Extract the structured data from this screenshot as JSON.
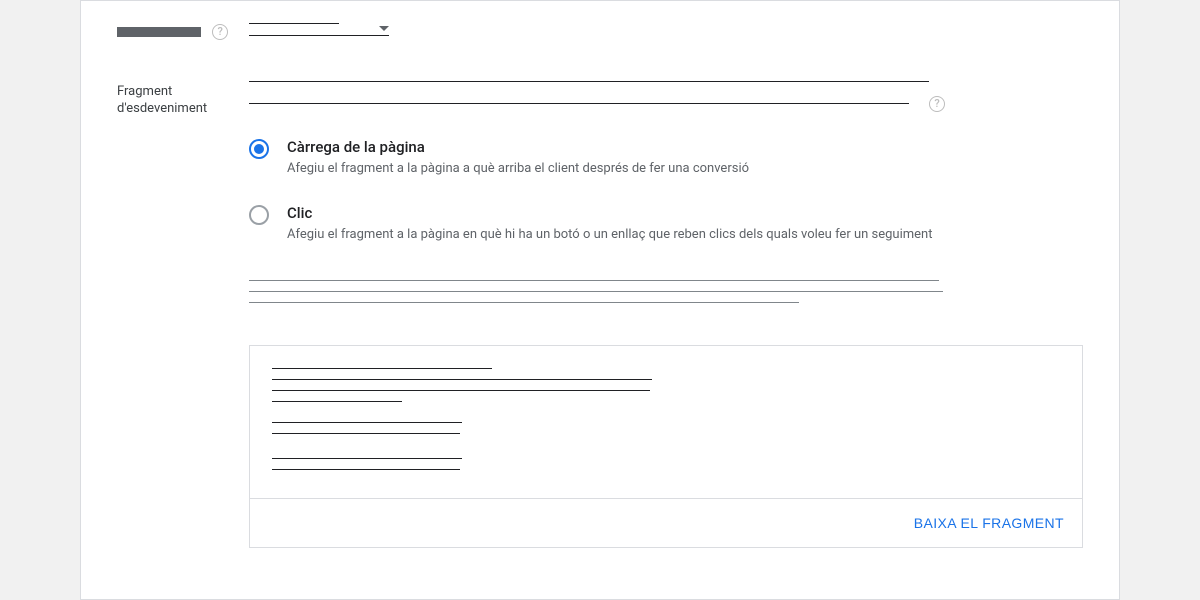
{
  "labels": {
    "event_fragment": "Fragment d'esdeveniment"
  },
  "radios": {
    "page_load": {
      "title": "Càrrega de la pàgina",
      "desc": "Afegiu el fragment a la pàgina a què arriba el client després de fer una conversió",
      "selected": true
    },
    "click": {
      "title": "Clic",
      "desc": "Afegiu el fragment a la pàgina en què hi ha un botó o un enllaç que reben clics dels quals voleu fer un seguiment",
      "selected": false
    }
  },
  "buttons": {
    "download_snippet": "BAIXA EL FRAGMENT"
  }
}
